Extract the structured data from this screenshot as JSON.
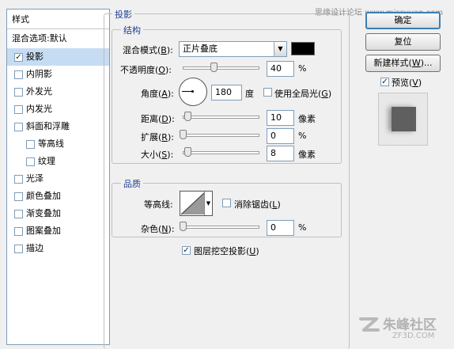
{
  "sidebar": {
    "header": "样式",
    "items": [
      {
        "label": "混合选项:默认",
        "checkbox": false,
        "selected": false
      },
      {
        "label": "投影",
        "checkbox": true,
        "checked": true,
        "selected": true
      },
      {
        "label": "内阴影",
        "checkbox": true,
        "checked": false
      },
      {
        "label": "外发光",
        "checkbox": true,
        "checked": false
      },
      {
        "label": "内发光",
        "checkbox": true,
        "checked": false
      },
      {
        "label": "斜面和浮雕",
        "checkbox": true,
        "checked": false
      },
      {
        "label": "等高线",
        "checkbox": true,
        "checked": false,
        "sub": true
      },
      {
        "label": "纹理",
        "checkbox": true,
        "checked": false,
        "sub": true
      },
      {
        "label": "光泽",
        "checkbox": true,
        "checked": false
      },
      {
        "label": "颜色叠加",
        "checkbox": true,
        "checked": false
      },
      {
        "label": "渐变叠加",
        "checkbox": true,
        "checked": false
      },
      {
        "label": "图案叠加",
        "checkbox": true,
        "checked": false
      },
      {
        "label": "描边",
        "checkbox": true,
        "checked": false
      }
    ]
  },
  "panel": {
    "title": "投影",
    "structure": {
      "title": "结构",
      "blend_mode_label": "混合模式",
      "blend_mode_key": "B",
      "blend_mode_value": "正片叠底",
      "blend_color": "#000000",
      "opacity_label": "不透明度",
      "opacity_key": "O",
      "opacity_value": "40",
      "opacity_unit": "%",
      "opacity_fraction": 0.4,
      "angle_label": "角度",
      "angle_key": "A",
      "angle_value": "180",
      "angle_unit": "度",
      "global_light_label": "使用全局光",
      "global_light_key": "G",
      "global_light_checked": false,
      "distance_label": "距离",
      "distance_key": "D",
      "distance_value": "10",
      "distance_unit": "像素",
      "spread_label": "扩展",
      "spread_key": "R",
      "spread_value": "0",
      "spread_unit": "%",
      "size_label": "大小",
      "size_key": "S",
      "size_value": "8",
      "size_unit": "像素"
    },
    "quality": {
      "title": "品质",
      "contour_label": "等高线",
      "antialias_label": "消除锯齿",
      "antialias_key": "L",
      "antialias_checked": false,
      "noise_label": "杂色",
      "noise_key": "N",
      "noise_value": "0",
      "noise_unit": "%"
    },
    "knockout_label": "图层挖空投影",
    "knockout_key": "U",
    "knockout_checked": true
  },
  "buttons": {
    "ok": "确定",
    "reset": "复位",
    "new_style": "新建样式",
    "new_style_key": "W",
    "preview_label": "预览",
    "preview_key": "V",
    "preview_checked": true
  },
  "watermark_top": "思缘设计论坛 www.missyuan.com",
  "watermark_bottom": "朱峰社区",
  "watermark_bottom_url": "ZF3D.COM",
  "icons": {
    "checked": "checkmark-icon",
    "dropdown": "chevron-down-icon"
  }
}
